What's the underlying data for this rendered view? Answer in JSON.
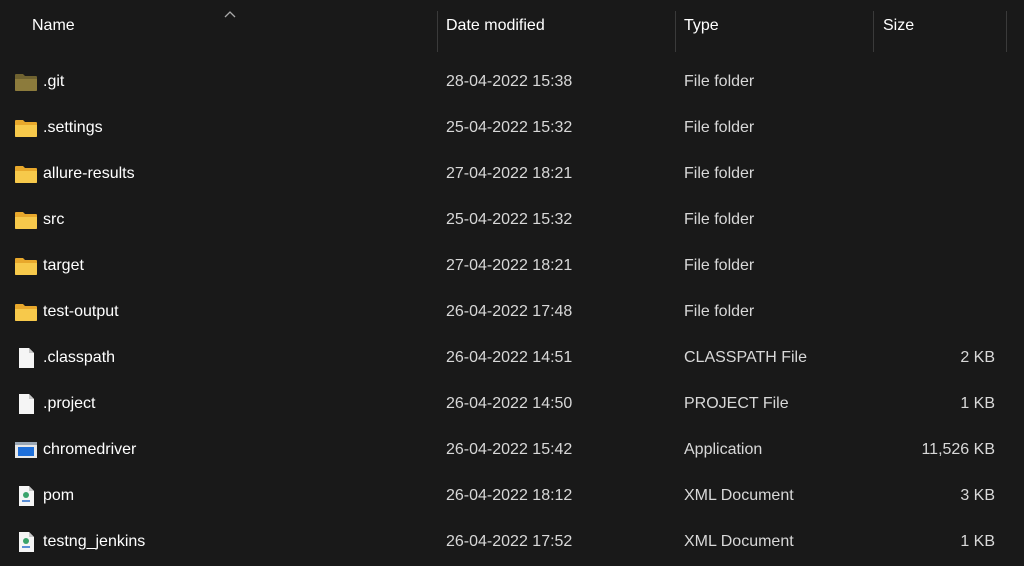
{
  "columns": {
    "name": "Name",
    "date": "Date modified",
    "type": "Type",
    "size": "Size"
  },
  "colors": {
    "background": "#191919",
    "folder": "#f4c34a",
    "git_folder": "#8a7a3a",
    "exe_blue": "#1e6fd9"
  },
  "files": [
    {
      "name": ".git",
      "date": "28-04-2022 15:38",
      "type": "File folder",
      "size": "",
      "icon": "git-folder-icon"
    },
    {
      "name": ".settings",
      "date": "25-04-2022 15:32",
      "type": "File folder",
      "size": "",
      "icon": "folder-icon"
    },
    {
      "name": "allure-results",
      "date": "27-04-2022 18:21",
      "type": "File folder",
      "size": "",
      "icon": "folder-icon"
    },
    {
      "name": "src",
      "date": "25-04-2022 15:32",
      "type": "File folder",
      "size": "",
      "icon": "folder-icon"
    },
    {
      "name": "target",
      "date": "27-04-2022 18:21",
      "type": "File folder",
      "size": "",
      "icon": "folder-icon"
    },
    {
      "name": "test-output",
      "date": "26-04-2022 17:48",
      "type": "File folder",
      "size": "",
      "icon": "folder-icon"
    },
    {
      "name": ".classpath",
      "date": "26-04-2022 14:51",
      "type": "CLASSPATH File",
      "size": "2 KB",
      "icon": "file-icon"
    },
    {
      "name": ".project",
      "date": "26-04-2022 14:50",
      "type": "PROJECT File",
      "size": "1 KB",
      "icon": "file-icon"
    },
    {
      "name": "chromedriver",
      "date": "26-04-2022 15:42",
      "type": "Application",
      "size": "11,526 KB",
      "icon": "application-icon"
    },
    {
      "name": "pom",
      "date": "26-04-2022 18:12",
      "type": "XML Document",
      "size": "3 KB",
      "icon": "xml-document-icon"
    },
    {
      "name": "testng_jenkins",
      "date": "26-04-2022 17:52",
      "type": "XML Document",
      "size": "1 KB",
      "icon": "xml-document-icon"
    }
  ]
}
